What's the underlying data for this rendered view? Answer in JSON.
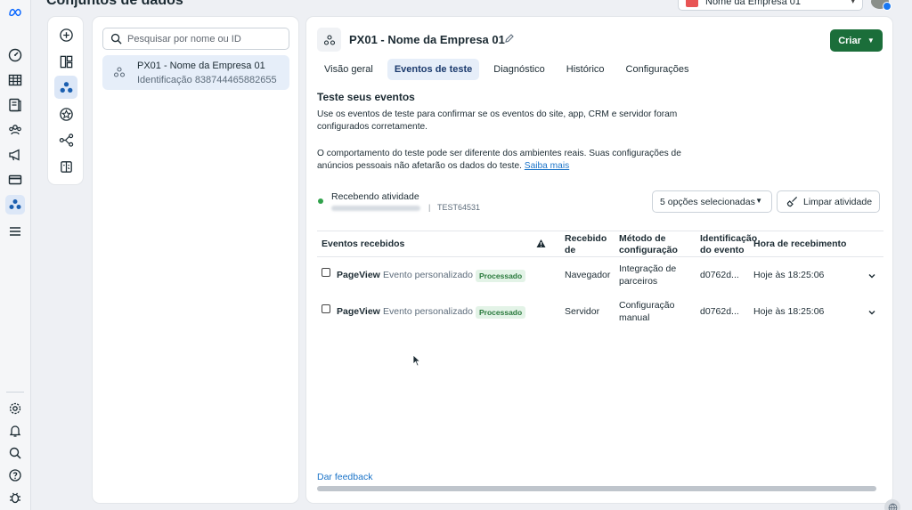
{
  "header": {
    "page_title": "Conjuntos de dados",
    "business_selector": "Nome da Empresa 01"
  },
  "rail": {
    "icons": [
      "meta-logo-icon",
      "dashboard-icon",
      "table-icon",
      "catalog-icon",
      "audience-icon",
      "campaign-icon",
      "billing-icon",
      "events-manager-icon",
      "menu-icon",
      "settings-icon",
      "notifications-icon",
      "search-icon",
      "help-icon",
      "bug-icon"
    ]
  },
  "list": {
    "search_placeholder": "Pesquisar por nome ou ID",
    "items": [
      {
        "name": "PX01 - Nome da Empresa 01",
        "id_label": "Identificação 838744465882655"
      }
    ]
  },
  "main": {
    "title": "PX01 - Nome da Empresa 01",
    "create_label": "Criar",
    "tabs": [
      "Visão geral",
      "Eventos de teste",
      "Diagnóstico",
      "Histórico",
      "Configurações"
    ],
    "active_tab": "Eventos de teste",
    "section_title": "Teste seus eventos",
    "desc1": "Use os eventos de teste para confirmar se os eventos do site, app, CRM e servidor foram configurados corretamente.",
    "desc2": "O comportamento do teste pode ser diferente dos ambientes reais. Suas configurações de anúncios pessoais não afetarão os dados do teste.",
    "learn_more": "Saiba mais",
    "activity_label": "Recebendo atividade",
    "activity_separator": "|",
    "activity_code": "TEST64531",
    "options_label": "5 opções selecionadas",
    "clear_label": "Limpar atividade",
    "feedback_label": "Dar feedback"
  },
  "table": {
    "headers": {
      "events": "Eventos recebidos",
      "received_from": "Recebido de",
      "method": "Método de configuração",
      "identification": "Identificação do evento",
      "time": "Hora de recebimento"
    },
    "rows": [
      {
        "event": "PageView",
        "type": "Evento personalizado",
        "status": "Processado",
        "received_from": "Navegador",
        "method": "Integração de parceiros",
        "id": "d0762d...",
        "time": "Hoje às 18:25:06"
      },
      {
        "event": "PageView",
        "type": "Evento personalizado",
        "status": "Processado",
        "received_from": "Servidor",
        "method": "Configuração manual",
        "id": "d0762d...",
        "time": "Hoje às 18:25:06"
      }
    ]
  },
  "colors": {
    "primary_button": "#1b6e3a",
    "active_tab_bg": "#e6eef9",
    "link": "#1a73c8",
    "status_green": "#31a24c"
  }
}
